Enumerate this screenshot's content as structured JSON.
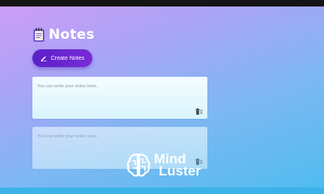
{
  "header": {
    "title": "Notes",
    "icon": "notepad-icon"
  },
  "toolbar": {
    "create_label": "Create Notes",
    "create_icon": "pen-icon"
  },
  "notes": [
    {
      "placeholder": "You can write your notes here..",
      "value": "",
      "icon": "trash-icon"
    },
    {
      "placeholder": "You can write your notes here..",
      "value": "",
      "icon": "trash-icon"
    }
  ],
  "watermark": {
    "line1": "Mind",
    "line2": "Luster",
    "icon": "brain-logo-icon"
  },
  "colors": {
    "button": "#6a25cf",
    "note_bg": "#e6f8fe",
    "top_bar": "#141414",
    "gradient_top": "#cf9cf7",
    "gradient_bottom": "#4dbcef"
  }
}
